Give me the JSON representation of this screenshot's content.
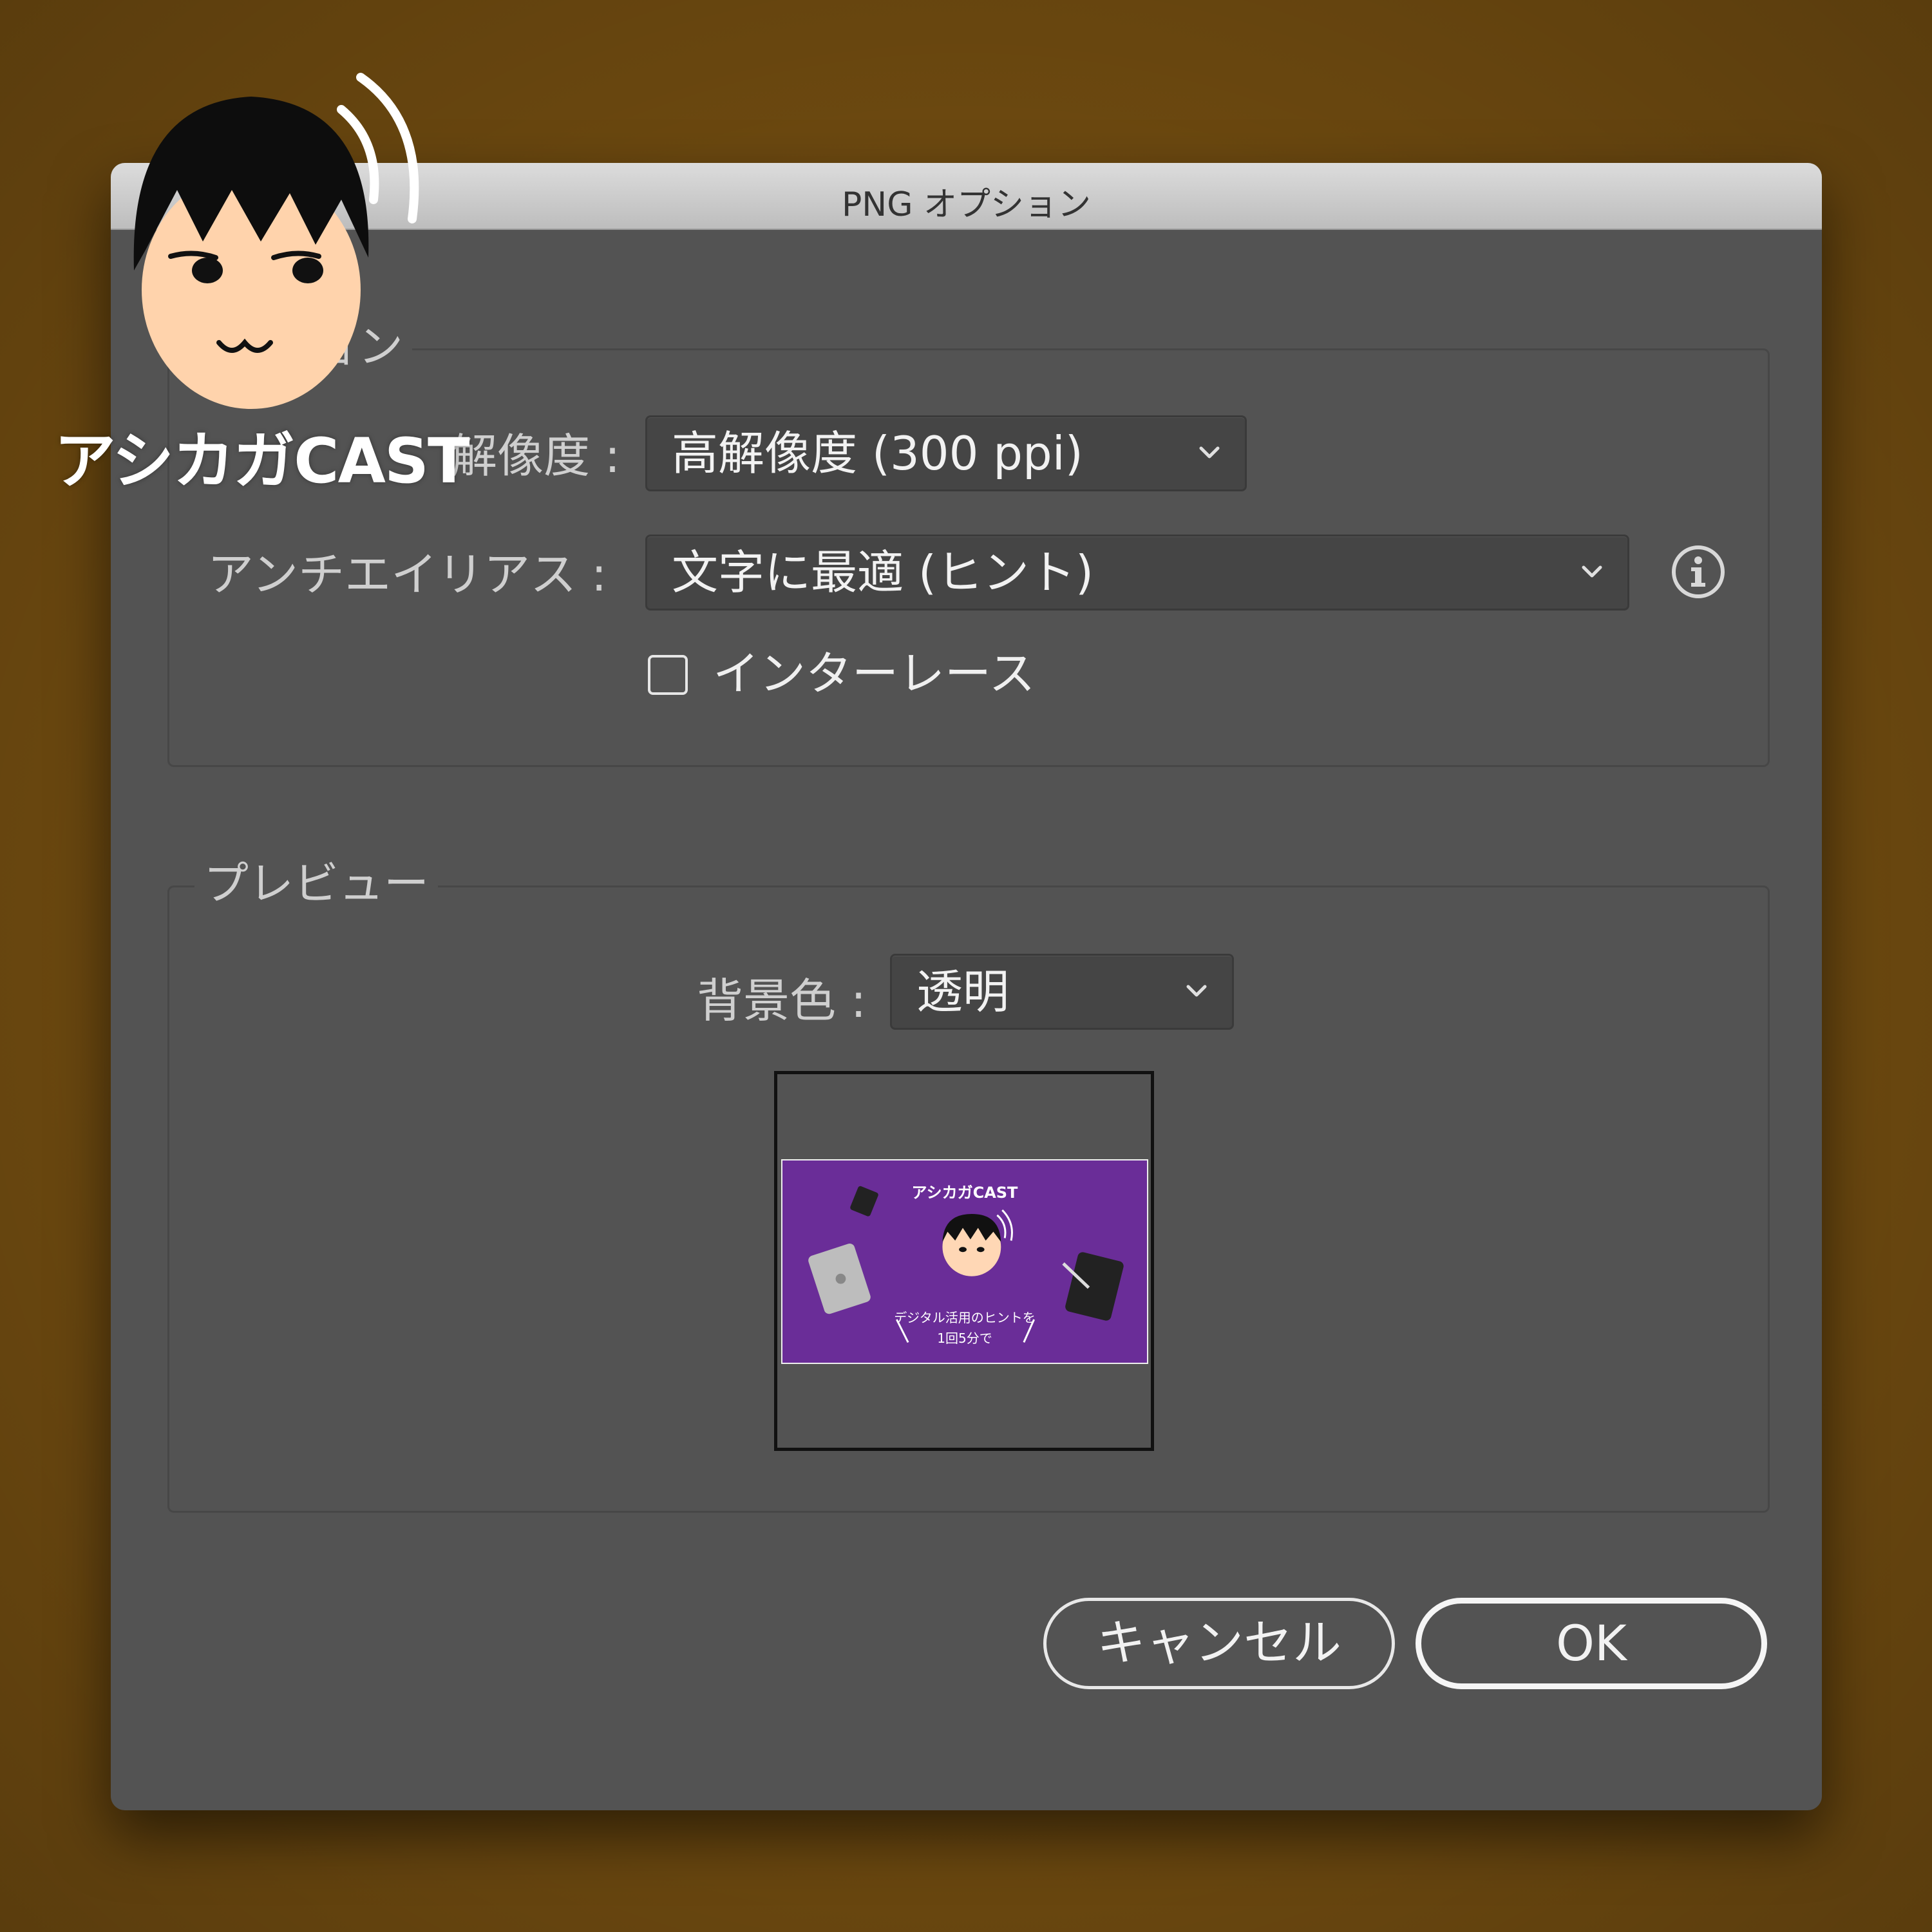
{
  "dialog": {
    "title": "PNG オプション"
  },
  "options_group": {
    "legend": "ョン",
    "resolution_label": "解像度 :",
    "resolution_value": "高解像度 (300 ppi)",
    "antialias_label": "アンチエイリアス :",
    "antialias_value": "文字に最適 (ヒント)",
    "interlace_label": "インターレース",
    "interlace_checked": false
  },
  "preview_group": {
    "legend": "プレビュー",
    "bg_label": "背景色 :",
    "bg_value": "透明",
    "thumb_title": "アシカガCAST",
    "thumb_caption_line1": "デジタル活用のヒントを",
    "thumb_caption_line2": "1回5分で"
  },
  "buttons": {
    "cancel": "キャンセル",
    "ok": "OK"
  },
  "watermark": {
    "text": "アシカガCAST"
  },
  "colors": {
    "background": "#6e4a10",
    "dialog": "#535353",
    "thumb_purple": "#6a2d98"
  },
  "icons": {
    "info": "info-icon",
    "chevron": "chevron-down-icon",
    "character": "character-face-icon"
  }
}
